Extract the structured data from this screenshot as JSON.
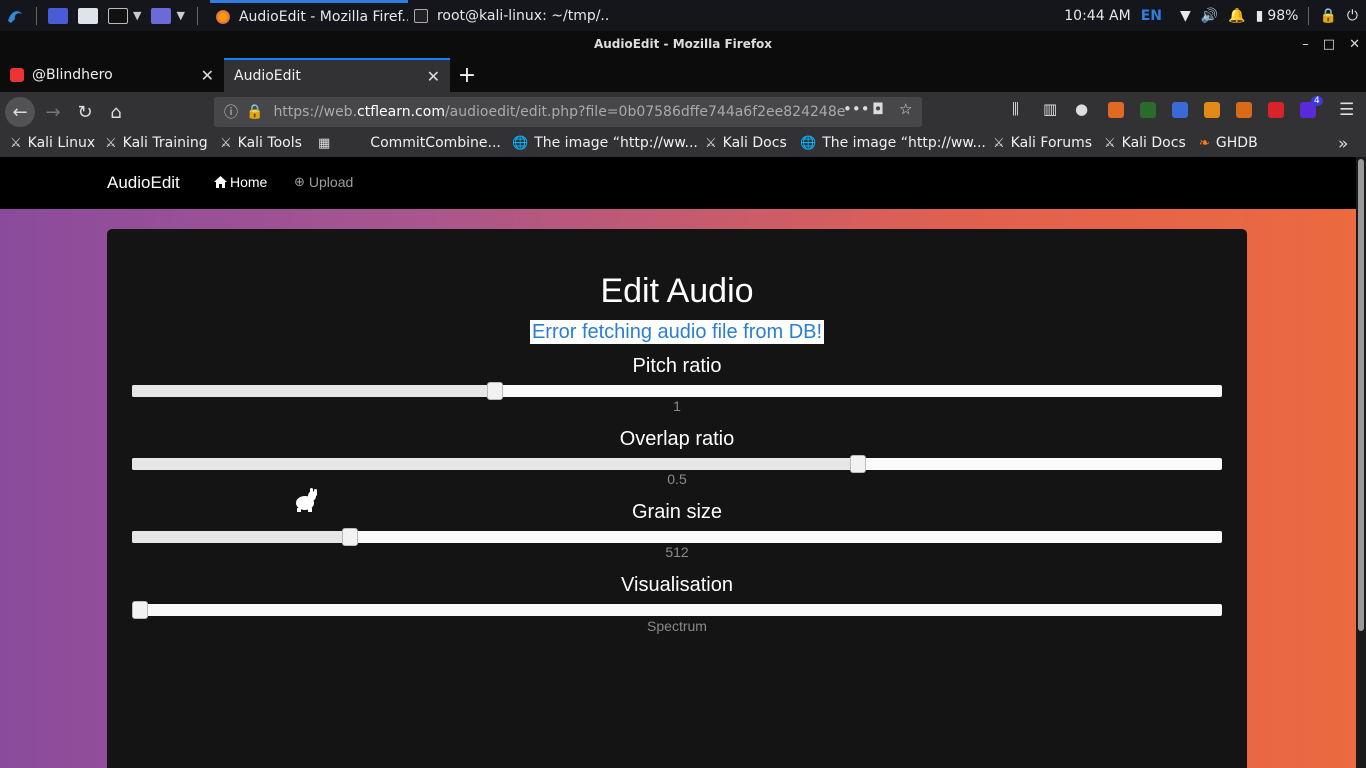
{
  "system_panel": {
    "tasks": [
      {
        "label": "AudioEdit - Mozilla Firef..."
      },
      {
        "label": "root@kali-linux: ~/tmp/..."
      }
    ],
    "clock": "10:44 AM",
    "keyboard_layout": "EN",
    "battery": "98%"
  },
  "browser": {
    "window_title": "AudioEdit - Mozilla Firefox",
    "tabs": [
      {
        "label": "@Blindhero"
      },
      {
        "label": "AudioEdit"
      }
    ],
    "url_prefix": "https://web.",
    "url_host": "ctflearn.com",
    "url_path": "/audioedit/edit.php?file=0b07586dffe744a6f2ee824248e",
    "extension_badge": "4",
    "bookmarks": [
      {
        "label": "Kali Linux"
      },
      {
        "label": "Kali Training"
      },
      {
        "label": "Kali Tools"
      },
      {
        "label": "CommitCombine..."
      },
      {
        "label": "The image “http://ww..."
      },
      {
        "label": "Kali Docs"
      },
      {
        "label": "The image “http://ww..."
      },
      {
        "label": "Kali Forums"
      },
      {
        "label": "Kali Docs"
      },
      {
        "label": "GHDB"
      }
    ]
  },
  "site": {
    "brand": "AudioEdit",
    "nav_home": "Home",
    "nav_upload": "Upload",
    "heading": "Edit Audio",
    "error": "Error fetching audio file from DB!",
    "controls": [
      {
        "label": "Pitch ratio",
        "value": "1",
        "fraction": 0.333
      },
      {
        "label": "Overlap ratio",
        "value": "0.5",
        "fraction": 0.666
      },
      {
        "label": "Grain size",
        "value": "512",
        "fraction": 0.2
      },
      {
        "label": "Visualisation",
        "value": "Spectrum",
        "fraction": 0.0
      }
    ]
  },
  "colors": {
    "error_text": "#2a7fd1",
    "card_bg": "#141414",
    "gradient_left": "#8a4b9d",
    "gradient_right": "#ec6a3e"
  }
}
